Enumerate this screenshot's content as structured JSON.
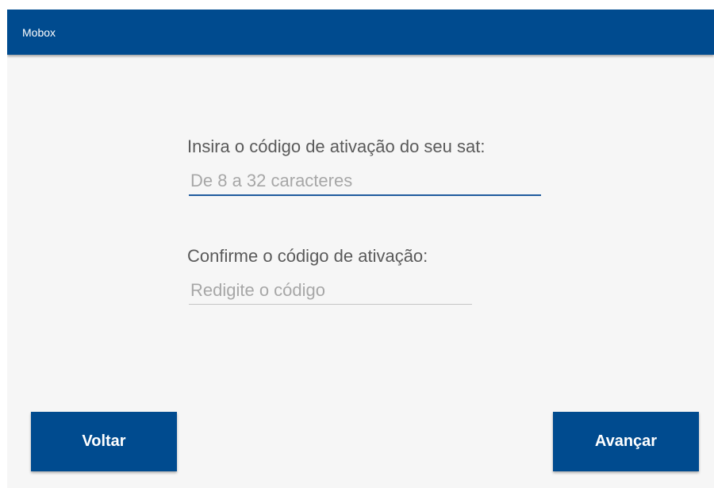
{
  "app_bar": {
    "title": "Mobox"
  },
  "form": {
    "activation": {
      "label": "Insira o código de ativação do seu sat:",
      "value": "",
      "placeholder": "De 8 a 32 caracteres"
    },
    "confirm": {
      "label": "Confirme o código de ativação:",
      "value": "",
      "placeholder": "Redigite o código"
    }
  },
  "actions": {
    "back_label": "Voltar",
    "next_label": "Avançar"
  },
  "colors": {
    "primary": "#004b8f",
    "background": "#f6f6f6",
    "focused_underline": "#1f5b9e",
    "idle_underline": "#c6c6c6"
  }
}
